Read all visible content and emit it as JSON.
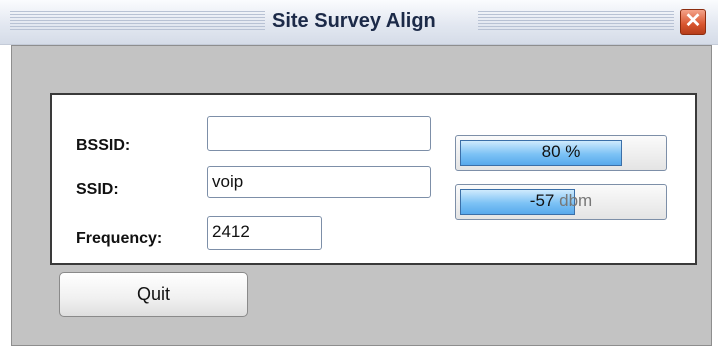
{
  "window": {
    "title": "Site Survey Align",
    "close_glyph": "✕"
  },
  "fields": {
    "bssid": {
      "label": "BSSID:",
      "value": ""
    },
    "ssid": {
      "label": "SSID:",
      "value": "voip"
    },
    "frequency": {
      "label": "Frequency:",
      "value": "2412"
    }
  },
  "signal_quality": {
    "text": "80 %",
    "fill_percent": 80
  },
  "signal_strength": {
    "value": "-57",
    "unit": "dbm",
    "fill_percent": 57
  },
  "buttons": {
    "quit_label": "Quit"
  },
  "colors": {
    "bar_fill": "#7cc2f5",
    "close_button": "#d8552e",
    "client_bg": "#c3c3c3"
  }
}
